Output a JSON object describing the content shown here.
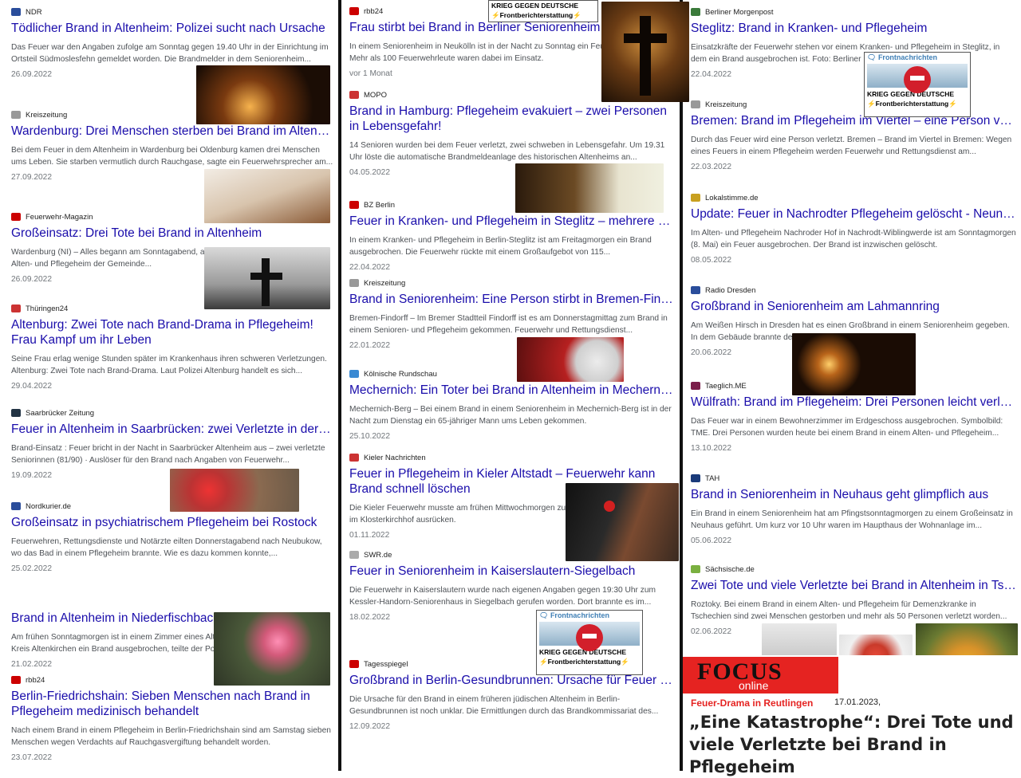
{
  "column1": [
    {
      "source": "NDR",
      "title": "Tödlicher Brand in Altenheim: Polizei sucht nach Ursache",
      "snippet": "Das Feuer war den Angaben zufolge am Sonntag gegen 19.40 Uhr in der Einrichtung im Ortsteil Südmoslesfehn gemeldet worden. Die Brandmelder in dem Seniorenheim...",
      "date": "26.09.2022"
    },
    {
      "source": "Kreiszeitung",
      "title": "Wardenburg: Drei Menschen sterben bei Brand im Altenheim",
      "snippet": "Bei dem Feuer in dem Altenheim in Wardenburg bei Oldenburg kamen drei Menschen ums Leben. Sie starben vermutlich durch Rauchgase, sagte ein Feuerwehrsprecher am...",
      "date": "27.09.2022"
    },
    {
      "source": "Feuerwehr-Magazin",
      "title": "Großeinsatz: Drei Tote bei Brand in Altenheim",
      "snippet": "Wardenburg (NI) – Alles begann am Sonntagabend, als die Brandmeldeanlage in einem Alten- und Pflegeheim der Gemeinde...",
      "date": "26.09.2022"
    },
    {
      "source": "Thüringen24",
      "title": "Altenburg: Zwei Tote nach Brand-Drama in Pflegeheim! Frau Kampf um ihr Leben",
      "snippet": "Seine Frau erlag wenige Stunden später im Krankenhaus ihren schweren Verletzungen. Altenburg: Zwei Tote nach Brand-Drama. Laut Polizei Altenburg handelt es sich...",
      "date": "29.04.2022"
    },
    {
      "source": "Saarbrücker Zeitung",
      "title": "Feuer in Altenheim in Saarbrücken: zwei Verletzte in der Nacht",
      "snippet": "Brand-Einsatz : Feuer bricht in der Nacht in Saarbrücker Altenheim aus – zwei verletzte Seniorinnen (81/90) · Auslöser für den Brand nach Angaben von Feuerwehr...",
      "date": "19.09.2022"
    },
    {
      "source": "Nordkurier.de",
      "title": "Großeinsatz in psychiatrischem Pflegeheim bei Rostock",
      "snippet": "Feuerwehren, Rettungsdienste und Notärzte eilten Donnerstagabend nach Neubukow, wo das Bad in einem Pflegeheim brannte. Wie es dazu kommen konnte,...",
      "date": "25.02.2022"
    },
    {
      "source": "",
      "title": "Brand in Altenheim in Niederfischbach - Bewohner schwer verletzt",
      "snippet": "Am frühen Sonntagmorgen ist in einem Zimmer eines Altenheims in Niederfischbach im Kreis Altenkirchen ein Brand ausgebrochen, teilte der Polizei...",
      "date": "21.02.2022"
    },
    {
      "source": "rbb24",
      "title": "Berlin-Friedrichshain: Sieben Menschen nach Brand in Pflegeheim medizinisch behandelt",
      "snippet": "Nach einem Brand in einem Pflegeheim in Berlin-Friedrichshain sind am Samstag sieben Menschen wegen Verdachts auf Rauchgasvergiftung behandelt worden.",
      "date": "23.07.2022"
    }
  ],
  "column2": [
    {
      "source": "rbb24",
      "title": "Frau stirbt bei Brand in Berliner Seniorenheim",
      "snippet": "In einem Seniorenheim in Neukölln ist in der Nacht zu Sonntag ein Feuer ausgebrochen. Mehr als 100 Feuerwehrleute waren dabei im Einsatz.",
      "date": "vor 1 Monat"
    },
    {
      "source": "MOPO",
      "title": "Brand in Hamburg: Pflegeheim evakuiert – zwei Personen in Lebensgefahr!",
      "snippet": "14 Senioren wurden bei dem Feuer verletzt, zwei schweben in Lebensgefahr. Um 19.31 Uhr löste die automatische Brandmeldeanlage des historischen Altenheims an...",
      "date": "04.05.2022"
    },
    {
      "source": "BZ Berlin",
      "title": "Feuer in Kranken- und Pflegeheim in Steglitz – mehrere Verletzte",
      "snippet": "In einem Kranken- und Pflegeheim in Berlin-Steglitz ist am Freitagmorgen ein Brand ausgebrochen. Die Feuerwehr rückte mit einem Großaufgebot von 115...",
      "date": "22.04.2022"
    },
    {
      "source": "Kreiszeitung",
      "title": "Brand in Seniorenheim: Eine Person stirbt in Bremen-Findorff",
      "snippet": "Bremen-Findorff – Im Bremer Stadtteil Findorff ist es am Donnerstagmittag zum Brand in einem Senioren- und Pflegeheim gekommen. Feuerwehr und Rettungsdienst...",
      "date": "22.01.2022"
    },
    {
      "source": "Kölnische Rundschau",
      "title": "Mechernich: Ein Toter bei Brand in Altenheim in Mechernich",
      "snippet": "Mechernich-Berg – Bei einem Brand in einem Seniorenheim in Mechernich-Berg ist in der Nacht zum Dienstag ein 65-jähriger Mann ums Leben gekommen.",
      "date": "25.10.2022"
    },
    {
      "source": "Kieler Nachrichten",
      "title": "Feuer in Pflegeheim in Kieler Altstadt – Feuerwehr kann Brand schnell löschen",
      "snippet": "Die Kieler Feuerwehr musste am frühen Mittwochmorgen zu einem Alten- und Pflegeheim im Klosterkirchhof ausrücken.",
      "date": "01.11.2022"
    },
    {
      "source": "SWR.de",
      "title": "Feuer in Seniorenheim in Kaiserslautern-Siegelbach",
      "snippet": "Die Feuerwehr in Kaiserslautern wurde nach eigenen Angaben gegen 19:30 Uhr zum Kessler-Handorn-Seniorenhaus in Siegelbach gerufen worden. Dort brannte es im...",
      "date": "18.02.2022"
    },
    {
      "source": "Tagesspiegel",
      "title": "Großbrand in Berlin-Gesundbrunnen: Ursache für Feuer in Altenheim",
      "snippet": "Die Ursache für den Brand in einem früheren jüdischen Altenheim in Berlin-Gesundbrunnen ist noch unklar. Die Ermittlungen durch das Brandkommissariat des...",
      "date": "12.09.2022"
    }
  ],
  "column3": [
    {
      "source": "Berliner Morgenpost",
      "title": "Steglitz: Brand in Kranken- und Pflegeheim",
      "snippet": "Einsatzkräfte der Feuerwehr stehen vor einem Kranken- und Pflegeheim in Steglitz, in dem ein Brand ausgebrochen ist. Foto: Berliner Morgenpost von...",
      "date": "22.04.2022"
    },
    {
      "source": "Kreiszeitung",
      "title": "Bremen: Brand im Pflegeheim im Viertel – eine Person verletzt",
      "snippet": "Durch das Feuer wird eine Person verletzt. Bremen – Brand im Viertel in Bremen: Wegen eines Feuers in einem Pflegeheim werden Feuerwehr und Rettungsdienst am...",
      "date": "22.03.2022"
    },
    {
      "source": "Lokalstimme.de",
      "title": "Update: Feuer in Nachrodter Pflegeheim gelöscht - Neun Verletzte",
      "snippet": "Im Alten- und Pflegeheim Nachroder Hof in Nachrodt-Wiblingwerde ist am Sonntagmorgen (8. Mai) ein Feuer ausgebrochen. Der Brand ist inzwischen gelöscht.",
      "date": "08.05.2022"
    },
    {
      "source": "Radio Dresden",
      "title": "Großbrand in Seniorenheim am Lahmannring",
      "snippet": "Am Weißen Hirsch in Dresden hat es einen Großbrand in einem Seniorenheim gegeben. In dem Gebäude brannte der Dachstuhl in Flammen...",
      "date": "20.06.2022"
    },
    {
      "source": "Taeglich.ME",
      "title": "Wülfrath: Brand im Pflegeheim: Drei Personen leicht verletzt",
      "snippet": "Das Feuer war in einem Bewohnerzimmer im Erdgeschoss ausgebrochen. Symbolbild: TME. Drei Personen wurden heute bei einem Brand in einem Alten- und Pflegeheim...",
      "date": "13.10.2022"
    },
    {
      "source": "TAH",
      "title": "Brand in Seniorenheim in Neuhaus geht glimpflich aus",
      "snippet": "Ein Brand in einem Seniorenheim hat am Pfingstsonntagmorgen zu einem Großeinsatz in Neuhaus geführt. Um kurz vor 10 Uhr waren im Haupthaus der Wohnanlage im...",
      "date": "05.06.2022"
    },
    {
      "source": "Sächsische.de",
      "title": "Zwei Tote und viele Verletzte bei Brand in Altenheim in Tschechien",
      "snippet": "Roztoky. Bei einem Brand in einem Alten- und Pflegeheim für Demenzkranke in Tschechien sind zwei Menschen gestorben und mehr als 50 Personen verletzt worden...",
      "date": "02.06.2022"
    }
  ],
  "badge": {
    "top": "KRIEG GEGEN DEUTSCHE",
    "bottom": "Frontberichterstattung",
    "channel": "Frontnachrichten"
  },
  "focus": {
    "logo_main": "FOCUS",
    "logo_sub": "online",
    "kicker": "Feuer-Drama in Reutlingen",
    "date": "17.01.2023,",
    "headline": "„Eine Katastrophe“: Drei Tote und viele Verletzte bei Brand in Pflegeheim"
  },
  "colors": {
    "link": "#1a0dab",
    "snippet": "#4d5156",
    "focus_red": "#e52321"
  }
}
